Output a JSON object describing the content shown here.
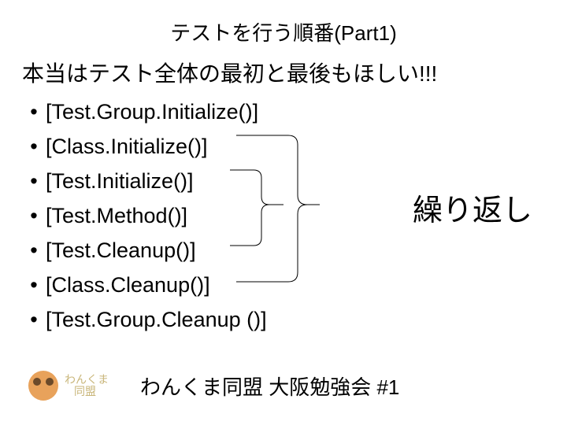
{
  "title": "テストを行う順番(Part1)",
  "intro": "本当はテスト全体の最初と最後もほしい!!!",
  "items": [
    "[Test.Group.Initialize()]",
    "[Class.Initialize()]",
    "[Test.Initialize()]",
    "[Test.Method()]",
    "[Test.Cleanup()]",
    "[Class.Cleanup()]",
    "[Test.Group.Cleanup ()]"
  ],
  "annotation": "繰り返し",
  "footer": {
    "logo_line1": "わんくま",
    "logo_line2": "同盟",
    "text": "わんくま同盟 大阪勉強会 #1"
  },
  "bullet_char": "•"
}
